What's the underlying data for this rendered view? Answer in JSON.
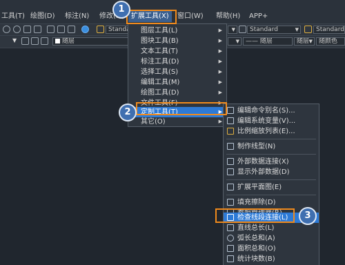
{
  "menubar": {
    "items": [
      "工具(T)",
      "绘图(D)",
      "标注(N)",
      "修改(M)",
      "扩展工具(X)",
      "窗口(W)",
      "帮助(H)",
      "APP+"
    ]
  },
  "toolbar": {
    "text_style": "Standard",
    "dim_style": "Standard",
    "right_style": "Standard",
    "layer": "随层",
    "linetype": "—— 随层",
    "lineweight": "随层",
    "plot_style": "随颜色"
  },
  "ext_menu": {
    "items": [
      "图层工具(L)",
      "图块工具(B)",
      "文本工具(T)",
      "标注工具(D)",
      "选择工具(S)",
      "编辑工具(M)",
      "绘图工具(D)",
      "文件工具(F)",
      "定制工具(T)",
      "其它(O)"
    ]
  },
  "custom_menu": {
    "items": [
      "编辑命令别名(S)...",
      "编辑系统变量(V)...",
      "比例缩放列表(E)...",
      "制作线型(N)",
      "外部数据连接(X)",
      "显示外部数据(D)",
      "扩展平面图(E)",
      "填充擦除(D)",
      "参照管理器(R)...",
      "检查线段连接(L)",
      "直线总长(L)",
      "弧长总和(A)",
      "面积总和(O)",
      "统计块数(B)"
    ]
  },
  "callouts": [
    "1",
    "2",
    "3"
  ],
  "colors": {
    "accent": "#f08a1c",
    "highlight": "#2d7ad6",
    "badge": "#3f6fb0"
  }
}
